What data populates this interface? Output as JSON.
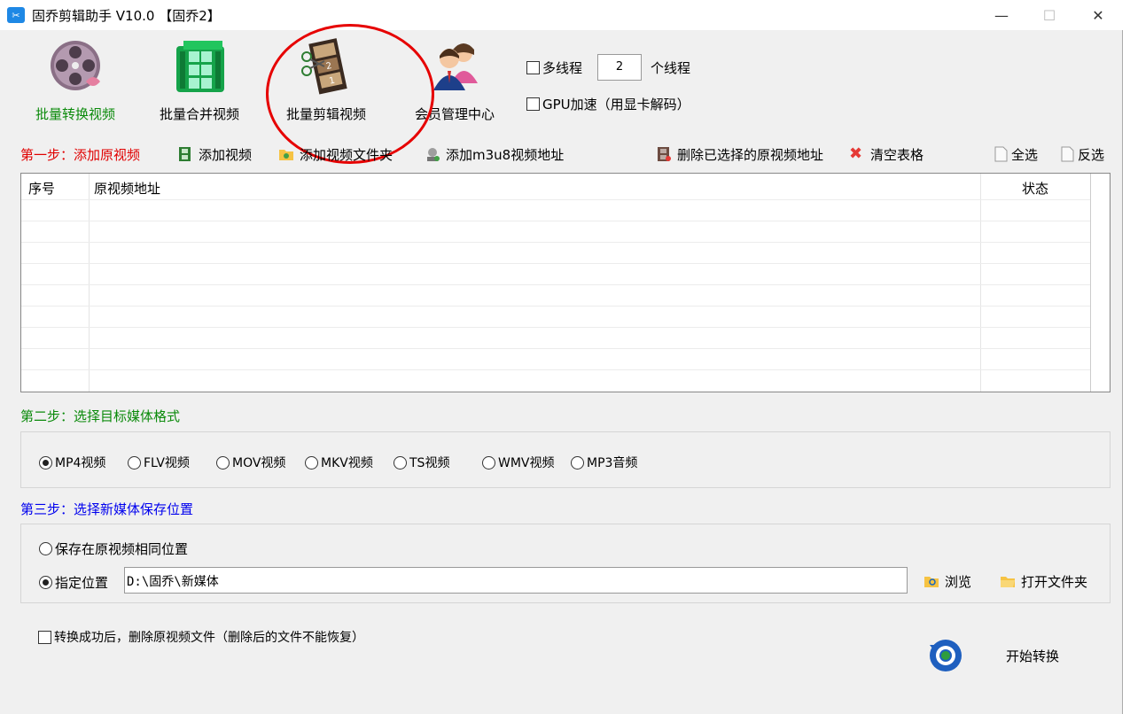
{
  "window": {
    "title": "固乔剪辑助手 V10.0 【固乔2】",
    "app_icon": "scissors-icon",
    "controls": {
      "minimize": "—",
      "maximize": "☐",
      "close": "✕"
    }
  },
  "toolbar": {
    "convert_label": "批量转换视频",
    "merge_label": "批量合并视频",
    "cut_label": "批量剪辑视频",
    "member_label": "会员管理中心"
  },
  "options": {
    "multithread_label": "多线程",
    "thread_count": "2",
    "thread_unit": "个线程",
    "gpu_label": "GPU加速（用显卡解码）"
  },
  "step1": {
    "title": "第一步：添加原视频",
    "add_video": "添加视频",
    "add_folder": "添加视频文件夹",
    "add_m3u8": "添加m3u8视频地址",
    "delete_selected": "删除已选择的原视频地址",
    "clear_table": "清空表格",
    "select_all": "全选",
    "invert_select": "反选"
  },
  "table": {
    "columns": [
      "序号",
      "原视频地址",
      "状态"
    ],
    "rows": []
  },
  "step2": {
    "title": "第二步：选择目标媒体格式",
    "formats": [
      "MP4视频",
      "FLV视频",
      "MOV视频",
      "MKV视频",
      "TS视频",
      "WMV视频",
      "MP3音频"
    ],
    "selected": "MP4视频"
  },
  "step3": {
    "title": "第三步：选择新媒体保存位置",
    "same_location": "保存在原视频相同位置",
    "custom_location": "指定位置",
    "path": "D:\\固乔\\新媒体",
    "browse": "浏览",
    "open_folder": "打开文件夹"
  },
  "footer": {
    "delete_after_label": "转换成功后，删除原视频文件（删除后的文件不能恢复）",
    "start_label": "开始转换"
  },
  "colors": {
    "step1": "#e00000",
    "step2": "#0a8a0a",
    "step3": "#0000ee",
    "annotation_circle": "#e60000",
    "active_tool": "#0a8a0a"
  }
}
